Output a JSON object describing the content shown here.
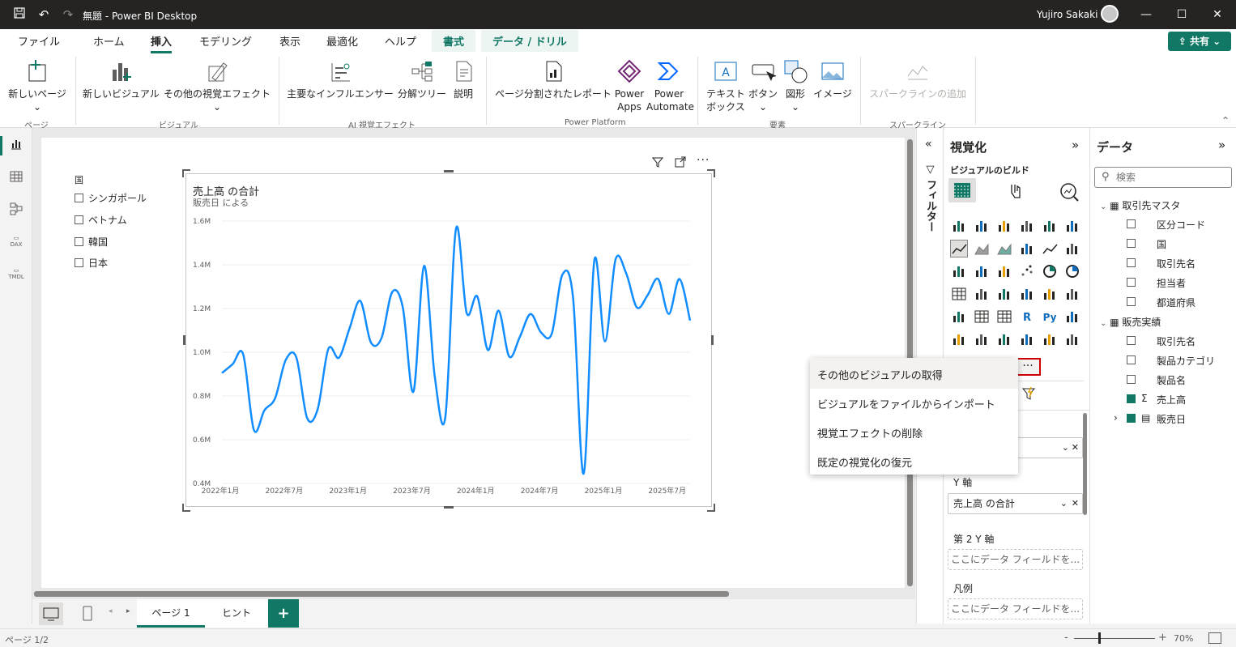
{
  "titlebar": {
    "title": "無題 - Power BI Desktop",
    "user": "Yujiro Sakaki"
  },
  "tabs": [
    "ファイル",
    "ホーム",
    "挿入",
    "モデリング",
    "表示",
    "最適化",
    "ヘルプ",
    "書式",
    "データ / ドリル"
  ],
  "share_label": "共有",
  "ribbon": {
    "new_page": "新しいページ",
    "new_visual": "新しいビジュアル",
    "more_visuals": "その他の視覚エフェクト",
    "key_influencers": "主要なインフルエンサー",
    "decomp_tree": "分解ツリー",
    "narrative": "説明",
    "paginated": "ページ分割されたレポート",
    "power_apps_1": "Power",
    "power_apps_2": "Apps",
    "power_automate_1": "Power",
    "power_automate_2": "Automate",
    "textbox_1": "テキスト",
    "textbox_2": "ボックス",
    "buttons": "ボタン",
    "shapes": "図形",
    "image": "イメージ",
    "sparkline": "スパークラインの追加",
    "groups": {
      "page": "ページ",
      "visual": "ビジュアル",
      "ai": "AI 視覚エフェクト",
      "pp": "Power Platform",
      "elements": "要素",
      "sparkline": "スパークライン"
    }
  },
  "slicer": {
    "header": "国",
    "items": [
      "シンガポール",
      "ベトナム",
      "韓国",
      "日本"
    ]
  },
  "chart_data": {
    "type": "line",
    "title": "売上高 の合計",
    "subtitle": "販売日 による",
    "ylim": [
      400000,
      1600000
    ],
    "yticks": [
      "1.6M",
      "1.4M",
      "1.2M",
      "1.0M",
      "0.8M",
      "0.6M",
      "0.4M"
    ],
    "ytick_values": [
      1600000,
      1400000,
      1200000,
      1000000,
      800000,
      600000,
      400000
    ],
    "xticks": [
      "2022年1月",
      "2022年7月",
      "2023年1月",
      "2023年7月",
      "2024年1月",
      "2024年7月",
      "2025年1月",
      "2025年7月"
    ],
    "color": "#118dff",
    "values": [
      905000,
      945000,
      990000,
      645000,
      735000,
      790000,
      965000,
      975000,
      700000,
      740000,
      1015000,
      975000,
      1110000,
      1235000,
      1045000,
      1065000,
      1275000,
      1205000,
      820000,
      1395000,
      890000,
      705000,
      1565000,
      1180000,
      1255000,
      1010000,
      1190000,
      980000,
      1070000,
      1175000,
      1090000,
      1085000,
      1355000,
      1250000,
      445000,
      1420000,
      1050000,
      1425000,
      1360000,
      1205000,
      1260000,
      1335000,
      1175000,
      1335000,
      1145000
    ]
  },
  "visual_toolbar": [
    "filter-icon",
    "focus-icon",
    "more-icon"
  ],
  "filters_label": "フィルター",
  "viz_pane": {
    "title": "視覚化",
    "subtitle": "ビジュアルのビルド",
    "more_label": "···",
    "wells": {
      "y_axis_label": "Y 軸",
      "y_axis_value": "売上高 の合計",
      "y2_label": "第 2 Y 軸",
      "y2_value": "ここにデータ フィールドを...",
      "legend_label": "凡例",
      "legend_value": "ここにデータ フィールドを..."
    }
  },
  "data_pane": {
    "title": "データ",
    "search_placeholder": "検索",
    "tables": [
      {
        "name": "取引先マスタ",
        "fields": [
          "区分コード",
          "国",
          "取引先名",
          "担当者",
          "都道府県"
        ]
      },
      {
        "name": "販売実績",
        "fields": [
          "取引先名",
          "製品カテゴリ",
          "製品名",
          "売上高",
          "販売日"
        ]
      }
    ]
  },
  "context_menu": {
    "items": [
      "その他のビジュアルの取得",
      "ビジュアルをファイルからインポート",
      "視覚エフェクトの削除",
      "既定の視覚化の復元"
    ]
  },
  "pages": [
    "ページ 1",
    "ヒント"
  ],
  "status": {
    "page": "ページ 1/2",
    "zoom": "70%"
  },
  "colors": {
    "accent": "#117865",
    "line": "#118dff",
    "highlight": "#d00000"
  }
}
